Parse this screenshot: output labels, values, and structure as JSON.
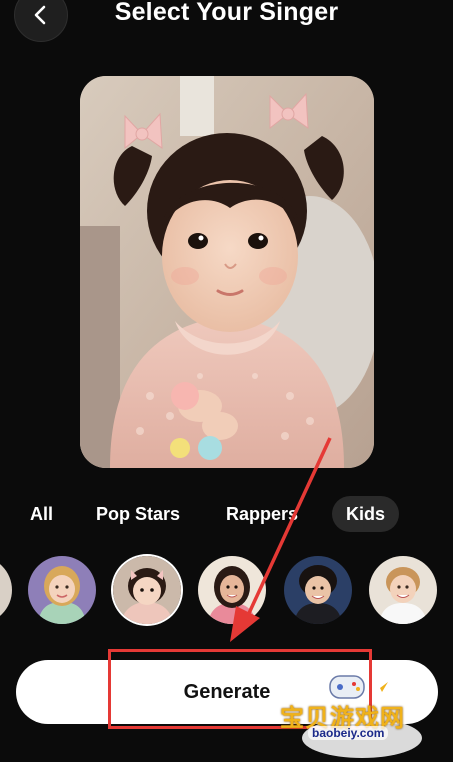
{
  "header": {
    "title": "Select Your Singer",
    "back_icon": "chevron-left-icon"
  },
  "preview": {
    "subject": "toddler girl with pigtails and pink bows in a lace dress"
  },
  "tabs": [
    {
      "label": "All",
      "active": false
    },
    {
      "label": "Pop Stars",
      "active": false
    },
    {
      "label": "Rappers",
      "active": false
    },
    {
      "label": "Kids",
      "active": true
    }
  ],
  "avatars": [
    {
      "name": "kid-avatar-partial",
      "selected": false
    },
    {
      "name": "kid-avatar-girl-blonde",
      "selected": false
    },
    {
      "name": "kid-avatar-toddler-pigtails",
      "selected": true
    },
    {
      "name": "kid-avatar-girl-dark-hair",
      "selected": false
    },
    {
      "name": "kid-avatar-boy-curly",
      "selected": false
    },
    {
      "name": "kid-avatar-boy-blonde",
      "selected": false
    }
  ],
  "generate": {
    "label": "Generate"
  },
  "annotation": {
    "color": "#e53935"
  },
  "watermark": {
    "text": "宝贝游戏网",
    "url": "baobeiy.com"
  }
}
